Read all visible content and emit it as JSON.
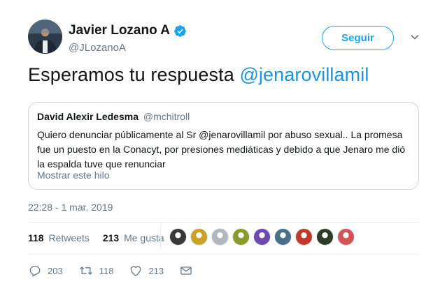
{
  "author": {
    "display_name": "Javier Lozano A",
    "handle": "@JLozanoA"
  },
  "follow_button": {
    "label": "Seguir"
  },
  "tweet": {
    "text": "Esperamos tu respuesta ",
    "mention": "@jenarovillamil"
  },
  "quoted_tweet": {
    "name": "David Alexir Ledesma",
    "handle": "@mchitroll",
    "text": "Quiero denunciar públicamente al Sr @jenarovillamil por abuso sexual.. La promesa fue un puesto en la Conacyt, por presiones mediáticas y debido a que Jenaro me dió la espalda tuve que renunciar",
    "show_thread": "Mostrar este hilo"
  },
  "timestamp": "22:28 - 1 mar. 2019",
  "stats": {
    "retweets_count": "118",
    "retweets_label": "Retweets",
    "likes_count": "213",
    "likes_label": "Me gusta"
  },
  "likers": [
    {
      "icon": "liker-avatar-1",
      "color": "#3a3a3a"
    },
    {
      "icon": "liker-avatar-2",
      "color": "#c9a227"
    },
    {
      "icon": "liker-avatar-3",
      "color": "#b0b7bd"
    },
    {
      "icon": "liker-avatar-4",
      "color": "#8a9a2b"
    },
    {
      "icon": "liker-avatar-5",
      "color": "#6f4bb0"
    },
    {
      "icon": "liker-avatar-6",
      "color": "#4a6f8c"
    },
    {
      "icon": "liker-avatar-7",
      "color": "#c0392b"
    },
    {
      "icon": "liker-avatar-8",
      "color": "#2f3b2a"
    },
    {
      "icon": "liker-avatar-9",
      "color": "#d35454"
    }
  ],
  "actions": {
    "replies": "203",
    "retweets": "118",
    "likes": "213"
  },
  "colors": {
    "accent": "#1da1f2",
    "mention": "#1b95e0",
    "secondary_text": "#657786",
    "border": "#ccd6dd"
  }
}
